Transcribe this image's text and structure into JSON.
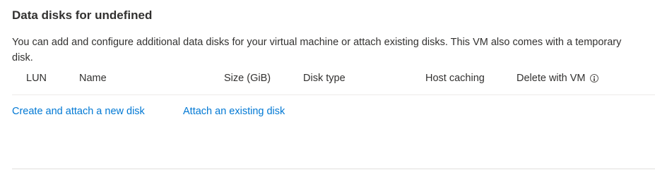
{
  "section": {
    "title": "Data disks for undefined",
    "description": "You can add and configure additional data disks for your virtual machine or attach existing disks. This VM also comes with a temporary disk."
  },
  "table": {
    "columns": {
      "lun": "LUN",
      "name": "Name",
      "size": "Size (GiB)",
      "disk_type": "Disk type",
      "host_caching": "Host caching",
      "delete_with_vm": "Delete with VM"
    },
    "info_icon": "info-icon",
    "rows": []
  },
  "actions": {
    "create_label": "Create and attach a new disk",
    "attach_label": "Attach an existing disk"
  },
  "colors": {
    "link": "#0078d4",
    "text": "#323130",
    "divider": "#edebe9"
  }
}
